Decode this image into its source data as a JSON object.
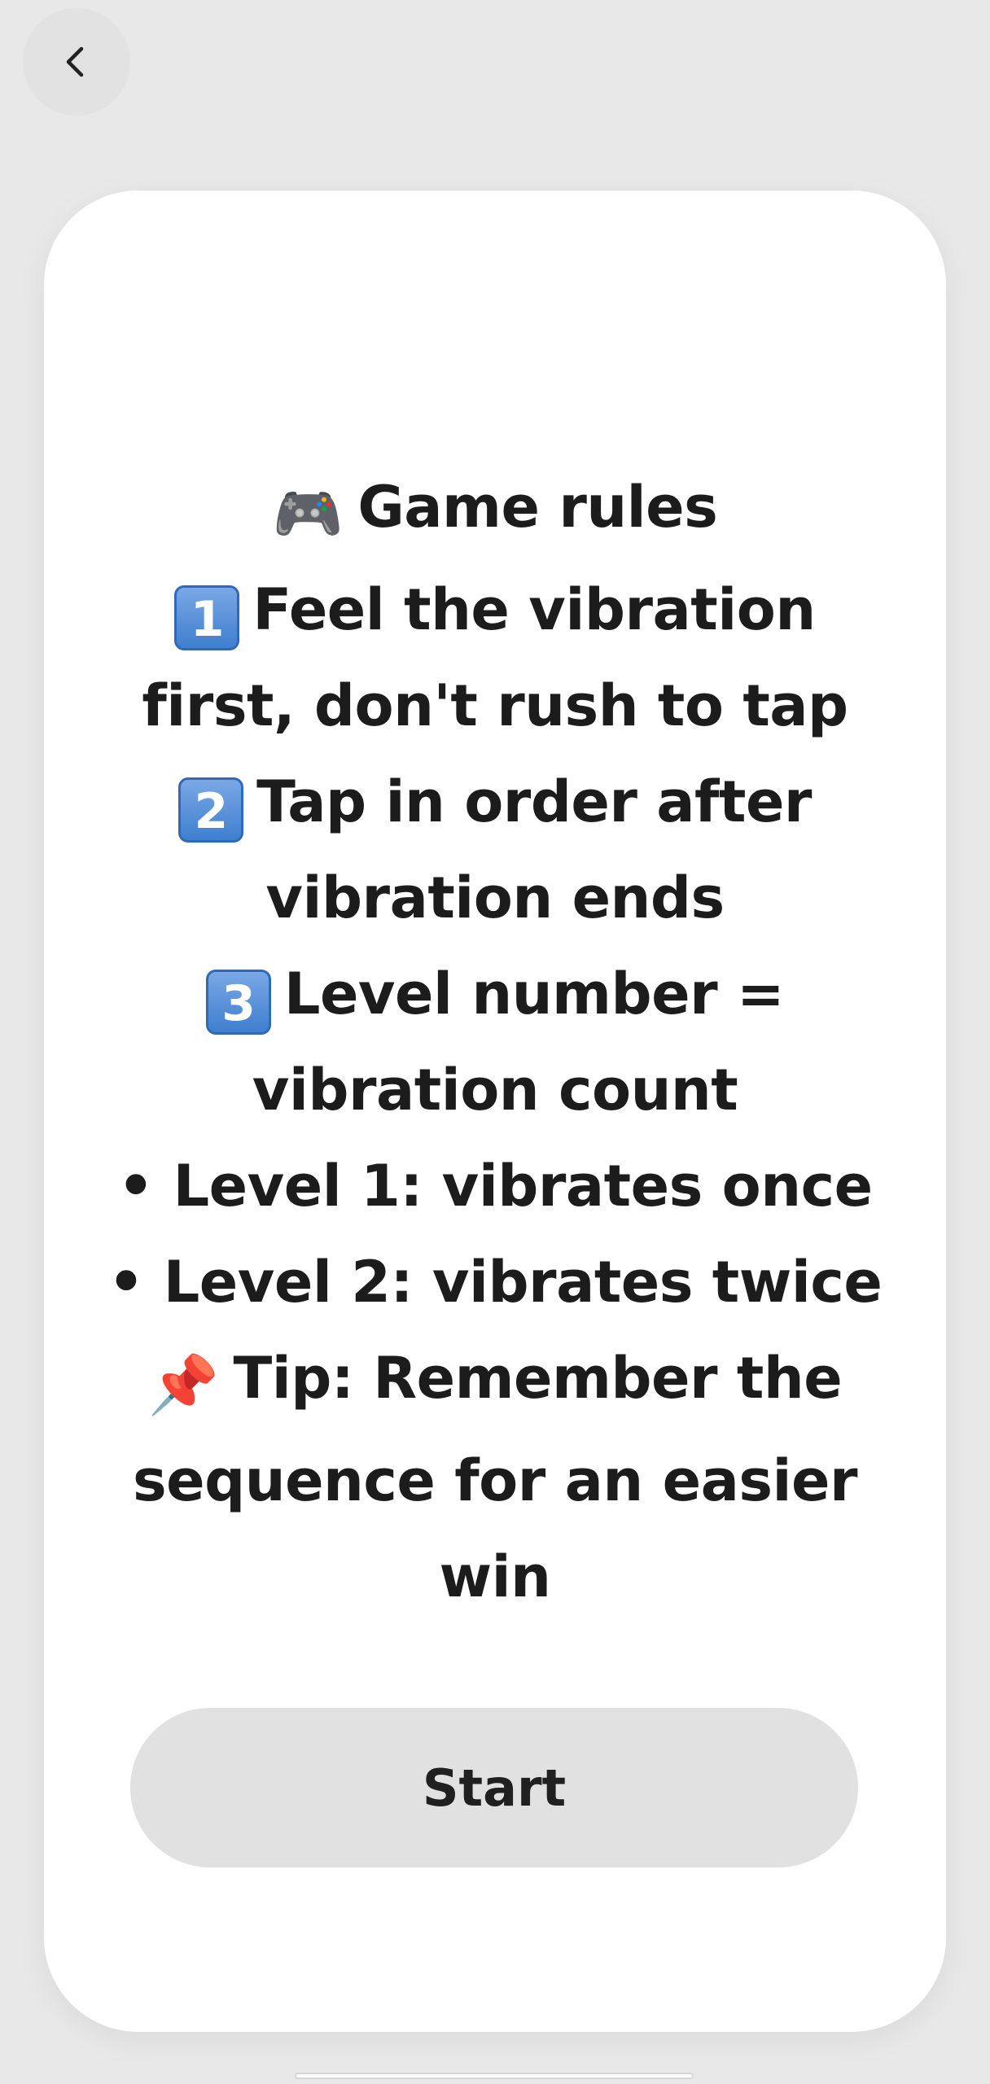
{
  "header": {
    "back_icon": "chevron-left-icon"
  },
  "rules": {
    "title_emoji": "🎮",
    "title": "Game rules",
    "rule1_num": "1",
    "rule1_line1": "Feel the vibration",
    "rule1_line2": "first, don't rush to tap",
    "rule2_num": "2",
    "rule2_line1": "Tap in order after",
    "rule2_line2": "vibration ends",
    "rule3_num": "3",
    "rule3_line1": "Level number =",
    "rule3_line2": "vibration count",
    "bullet1": "• Level 1: vibrates once",
    "bullet2": "• Level 2: vibrates twice",
    "tip_emoji": "📌",
    "tip_line1": "Tip: Remember the",
    "tip_line2": "sequence for an easier",
    "tip_line3": "win"
  },
  "actions": {
    "start_label": "Start"
  }
}
